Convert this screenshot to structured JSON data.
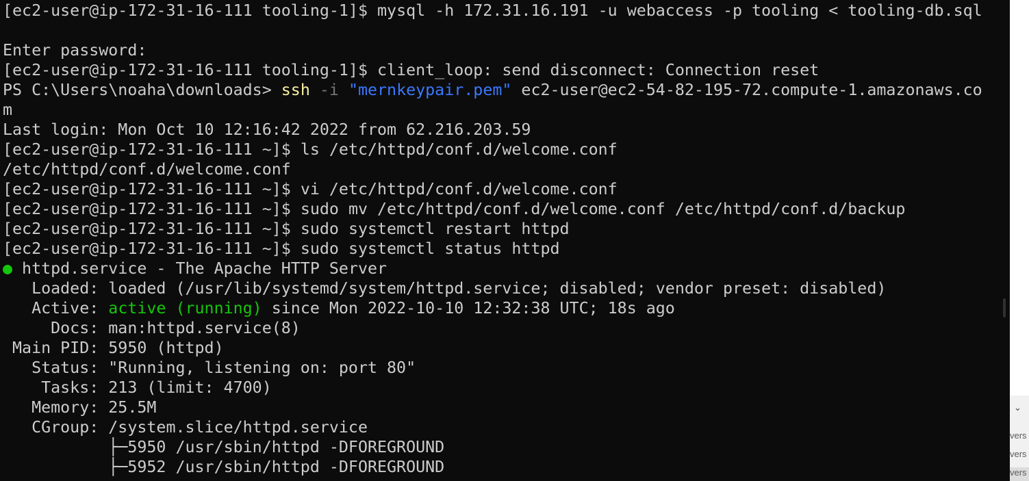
{
  "terminal": {
    "lines": [
      {
        "prompt": "[ec2-user@ip-172-31-16-111 tooling-1]$ ",
        "rest": "mysql -h 172.31.16.191 -u webaccess -p tooling < tooling-db.sql"
      },
      {
        "text": ""
      },
      {
        "text": "Enter password:"
      },
      {
        "prompt": "[ec2-user@ip-172-31-16-111 tooling-1]$ ",
        "rest": "client_loop: send disconnect: Connection reset"
      },
      {
        "ps_prefix": "PS C:\\Users\\noaha\\downloads> ",
        "ps_cmd": "ssh",
        "ps_flag": " -i ",
        "ps_str": "\"mernkeypair.pem\"",
        "ps_rest": " ec2-user@ec2-54-82-195-72.compute-1.amazonaws.co"
      },
      {
        "text": "m"
      },
      {
        "text": "Last login: Mon Oct 10 12:16:42 2022 from 62.216.203.59"
      },
      {
        "prompt": "[ec2-user@ip-172-31-16-111 ~]$ ",
        "rest": "ls /etc/httpd/conf.d/welcome.conf"
      },
      {
        "text": "/etc/httpd/conf.d/welcome.conf"
      },
      {
        "prompt": "[ec2-user@ip-172-31-16-111 ~]$ ",
        "rest": "vi /etc/httpd/conf.d/welcome.conf"
      },
      {
        "prompt": "[ec2-user@ip-172-31-16-111 ~]$ ",
        "rest": "sudo mv /etc/httpd/conf.d/welcome.conf /etc/httpd/conf.d/backup"
      },
      {
        "prompt": "[ec2-user@ip-172-31-16-111 ~]$ ",
        "rest": "sudo systemctl restart httpd"
      },
      {
        "prompt": "[ec2-user@ip-172-31-16-111 ~]$ ",
        "rest": "sudo systemctl status httpd"
      },
      {
        "dot": "●",
        "text": " httpd.service - The Apache HTTP Server"
      },
      {
        "text": "   Loaded: loaded (/usr/lib/systemd/system/httpd.service; disabled; vendor preset: disabled)"
      },
      {
        "label": "   Active: ",
        "green": "active (running)",
        "rest2": " since Mon 2022-10-10 12:32:38 UTC; 18s ago"
      },
      {
        "text": "     Docs: man:httpd.service(8)"
      },
      {
        "text": " Main PID: 5950 (httpd)"
      },
      {
        "text": "   Status: \"Running, listening on: port 80\""
      },
      {
        "text": "    Tasks: 213 (limit: 4700)"
      },
      {
        "text": "   Memory: 25.5M"
      },
      {
        "text": "   CGroup: /system.slice/httpd.service"
      },
      {
        "text": "           ├─5950 /usr/sbin/httpd -DFOREGROUND"
      },
      {
        "text": "           ├─5952 /usr/sbin/httpd -DFOREGROUND"
      }
    ]
  },
  "side_panel": {
    "chevron_icon": "chevron-down-icon",
    "items": [
      "vers",
      "vers",
      "vers"
    ]
  }
}
